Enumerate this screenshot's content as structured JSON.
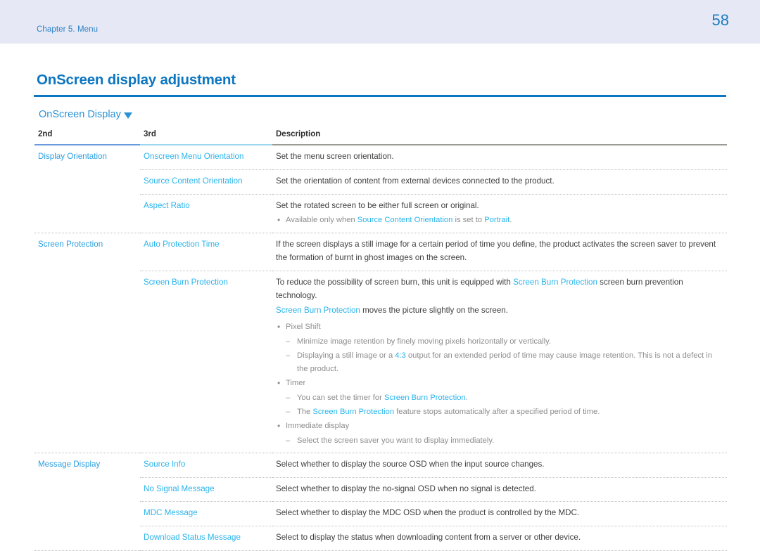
{
  "header": {
    "chapter": "Chapter 5. Menu",
    "page_number": "58",
    "band_color": "#e6e9f5",
    "text_color": "#2a7fc4"
  },
  "title": {
    "text": "OnScreen display adjustment",
    "rule_color": "#0d76c0"
  },
  "section": {
    "heading": "OnScreen Display",
    "marker": "triangle-down-icon"
  },
  "table": {
    "headers": {
      "col2": "2nd",
      "col3": "3rd",
      "desc": "Description"
    },
    "underline_colors": {
      "col2": "#6b9bdd",
      "col3": "#9bd8ef",
      "desc": "#9b9b96"
    },
    "groups": [
      {
        "name": "Display Orientation",
        "rows": [
          {
            "third": "Onscreen Menu Orientation",
            "desc": "Set the menu screen orientation."
          },
          {
            "third": "Source Content Orientation",
            "desc": "Set the orientation of content from external devices connected to the product."
          },
          {
            "third": "Aspect Ratio",
            "desc": "Set the rotated screen to be either full screen or original.",
            "note_parts": [
              {
                "t": "Available only when ",
                "hl": false
              },
              {
                "t": "Source Content Orientation",
                "hl": true
              },
              {
                "t": " is set to ",
                "hl": false
              },
              {
                "t": "Portrait",
                "hl": true
              },
              {
                "t": ".",
                "hl": false
              }
            ]
          }
        ]
      },
      {
        "name": "Screen Protection",
        "rows": [
          {
            "third": "Auto Protection Time",
            "desc": "If the screen displays a still image for a certain period of time you define, the product activates the screen saver to prevent the formation of burnt in ghost images on the screen."
          },
          {
            "third": "Screen Burn Protection",
            "desc_parts": [
              {
                "t": "To reduce the possibility of screen burn, this unit is equipped with ",
                "hl": false
              },
              {
                "t": "Screen Burn Protection",
                "hl": true
              },
              {
                "t": " screen burn prevention technology.",
                "hl": false
              }
            ],
            "desc_line2_parts": [
              {
                "t": "Screen Burn Protection",
                "hl": true
              },
              {
                "t": " moves the picture slightly on the screen.",
                "hl": false
              }
            ],
            "bullets": [
              {
                "label": "Pixel Shift",
                "dashes": [
                  {
                    "parts": [
                      {
                        "t": "Minimize image retention by finely moving pixels horizontally or vertically.",
                        "hl": false
                      }
                    ]
                  },
                  {
                    "parts": [
                      {
                        "t": "Displaying a still image or a ",
                        "hl": false
                      },
                      {
                        "t": "4:3",
                        "hl": true
                      },
                      {
                        "t": " output for an extended period of time may cause image retention. This is not a defect in the product.",
                        "hl": false
                      }
                    ]
                  }
                ]
              },
              {
                "label": "Timer",
                "dashes": [
                  {
                    "parts": [
                      {
                        "t": "You can set the timer for ",
                        "hl": false
                      },
                      {
                        "t": "Screen Burn Protection",
                        "hl": true
                      },
                      {
                        "t": ".",
                        "hl": false
                      }
                    ]
                  },
                  {
                    "parts": [
                      {
                        "t": "The ",
                        "hl": false
                      },
                      {
                        "t": "Screen Burn Protection",
                        "hl": true
                      },
                      {
                        "t": " feature stops automatically after a specified period of time.",
                        "hl": false
                      }
                    ]
                  }
                ]
              },
              {
                "label": "Immediate display",
                "dashes": [
                  {
                    "parts": [
                      {
                        "t": "Select the screen saver you want to display immediately.",
                        "hl": false
                      }
                    ]
                  }
                ]
              }
            ]
          }
        ]
      },
      {
        "name": "Message Display",
        "rows": [
          {
            "third": "Source Info",
            "desc": "Select whether to display the source OSD when the input source changes."
          },
          {
            "third": "No Signal Message",
            "desc": "Select whether to display the no-signal OSD when no signal is detected."
          },
          {
            "third": "MDC Message",
            "desc": "Select whether to display the MDC OSD when the product is controlled by the MDC."
          },
          {
            "third": "Download Status Message",
            "desc": "Select to display the status when downloading content from a server or other device."
          }
        ]
      }
    ]
  }
}
